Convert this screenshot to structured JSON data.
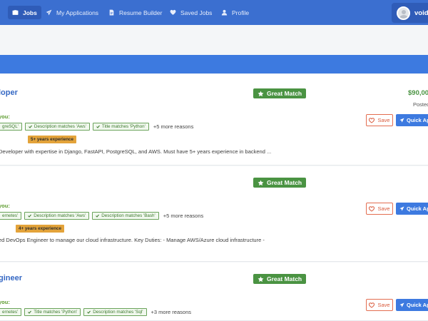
{
  "nav": {
    "items": [
      {
        "label": "Jobs",
        "icon": "briefcase-icon",
        "active": true
      },
      {
        "label": "My Applications",
        "icon": "paper-plane-icon",
        "active": false
      },
      {
        "label": "Resume Builder",
        "icon": "document-icon",
        "active": false
      },
      {
        "label": "Saved Jobs",
        "icon": "heart-icon",
        "active": false
      },
      {
        "label": "Profile",
        "icon": "user-icon",
        "active": false
      }
    ],
    "user_name": "voidm"
  },
  "jobs": [
    {
      "title": "loper",
      "match_label": "Great Match",
      "salary": "$90,00",
      "posted": "Posted",
      "why_label": "you:",
      "reasons": [
        "greSQL'",
        "Description matches 'Aws'",
        "Title matches 'Python'"
      ],
      "more_reasons": "+5 more reasons",
      "experience": "5+ years experience",
      "description": "Developer with expertise in Django, FastAPI, PostgreSQL, and AWS. Must have 5+ years experience in backend ...",
      "save_label": "Save",
      "apply_label": "Quick Ap"
    },
    {
      "title": "",
      "match_label": "Great Match",
      "why_label": "you:",
      "reasons": [
        "ernetes'",
        "Description matches 'Aws'",
        "Description matches 'Bash'"
      ],
      "more_reasons": "+5 more reasons",
      "experience": "4+ years experience",
      "description": "ed DevOps Engineer to manage our cloud infrastructure. Key Duties: - Manage AWS/Azure cloud infrastructure -",
      "save_label": "Save",
      "apply_label": "Quick Ap"
    },
    {
      "title": "gineer",
      "match_label": "Great Match",
      "why_label": "you:",
      "reasons": [
        "ernetes'",
        "Title matches 'Python'",
        "Description matches 'Sql'"
      ],
      "more_reasons": "+3 more reasons",
      "save_label": "Save",
      "apply_label": "Quick Ap"
    }
  ],
  "colors": {
    "nav_bg": "#3b6fd0",
    "accent": "#3d7ae0",
    "match_green": "#4a9342",
    "experience_orange": "#e3a33a",
    "save_red": "#d95a3c"
  }
}
